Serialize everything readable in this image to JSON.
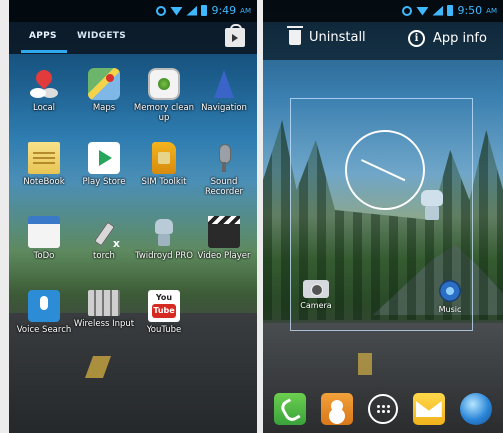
{
  "left_screen": {
    "status_time": "9:49",
    "status_ampm": "AM",
    "tabs": [
      "APPS",
      "WIDGETS"
    ],
    "apps": [
      {
        "label": "Local",
        "icon": "location-pin-icon"
      },
      {
        "label": "Maps",
        "icon": "maps-icon"
      },
      {
        "label": "Memory clean up",
        "icon": "memory-cleanup-icon"
      },
      {
        "label": "Navigation",
        "icon": "navigation-arrow-icon"
      },
      {
        "label": "NoteBook",
        "icon": "notebook-icon"
      },
      {
        "label": "Play Store",
        "icon": "play-store-icon"
      },
      {
        "label": "SIM Toolkit",
        "icon": "sim-card-icon"
      },
      {
        "label": "Sound Recorder",
        "icon": "microphone-icon"
      },
      {
        "label": "ToDo",
        "icon": "todo-icon"
      },
      {
        "label": "torch",
        "icon": "torch-icon"
      },
      {
        "label": "Twidroyd PRO",
        "icon": "twidroyd-robot-icon"
      },
      {
        "label": "Video Player",
        "icon": "video-clapper-icon"
      },
      {
        "label": "Voice Search",
        "icon": "voice-search-icon"
      },
      {
        "label": "Wireless Input",
        "icon": "keyboard-icon"
      },
      {
        "label": "YouTube",
        "icon": "youtube-icon"
      }
    ],
    "youtube_logo": {
      "top": "You",
      "bottom": "Tube"
    }
  },
  "right_screen": {
    "status_time": "9:50",
    "status_ampm": "AM",
    "actions": {
      "uninstall": "Uninstall",
      "app_info": "App info",
      "info_glyph": "i"
    },
    "shortcuts": [
      {
        "label": "Camera",
        "icon": "camera-icon"
      },
      {
        "label": "Music",
        "icon": "music-icon"
      }
    ],
    "dock": [
      "phone-icon",
      "contacts-icon",
      "app-drawer-icon",
      "messaging-icon",
      "browser-icon"
    ]
  }
}
